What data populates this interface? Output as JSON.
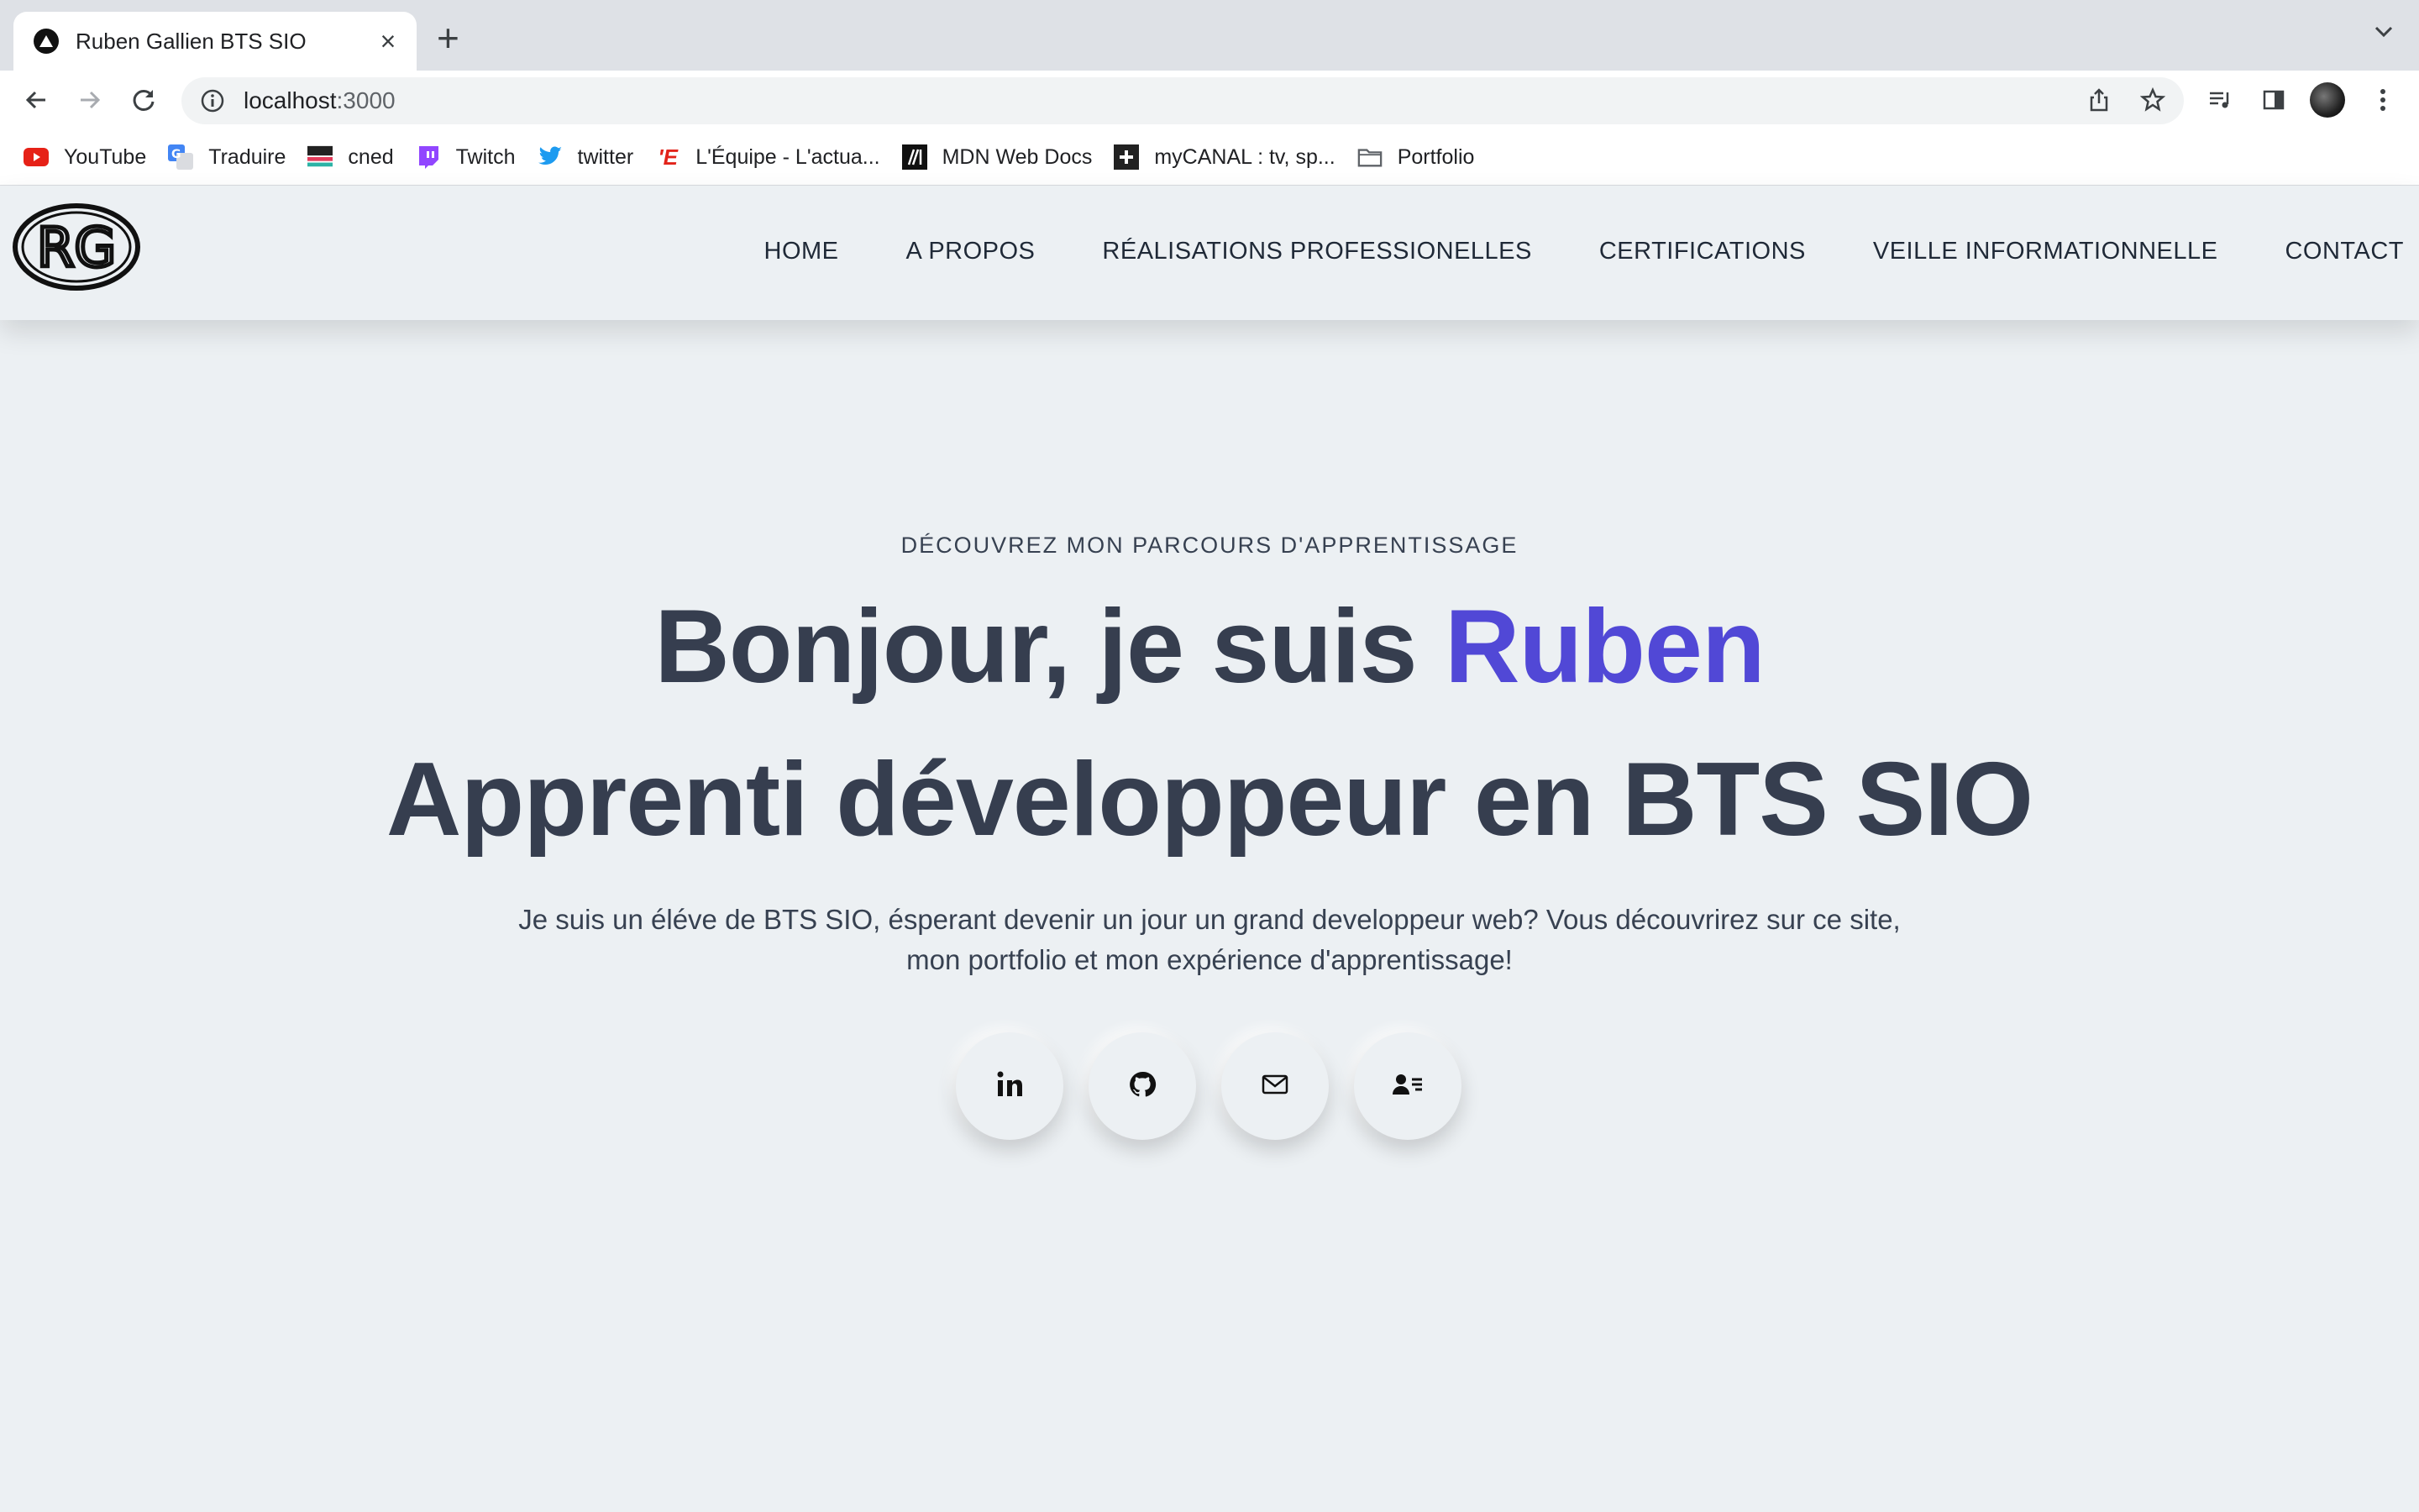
{
  "browser": {
    "tab_title": "Ruben Gallien BTS SIO",
    "url_host": "localhost",
    "url_port": ":3000",
    "bookmarks": [
      {
        "label": "YouTube",
        "icon": "youtube-icon"
      },
      {
        "label": "Traduire",
        "icon": "translate-icon"
      },
      {
        "label": "cned",
        "icon": "cned-icon"
      },
      {
        "label": "Twitch",
        "icon": "twitch-icon"
      },
      {
        "label": "twitter",
        "icon": "twitter-icon"
      },
      {
        "label": "L'Équipe - L'actua...",
        "icon": "lequipe-icon"
      },
      {
        "label": "MDN Web Docs",
        "icon": "mdn-icon"
      },
      {
        "label": "myCANAL : tv, sp...",
        "icon": "mycanal-icon"
      },
      {
        "label": "Portfolio",
        "icon": "folder-icon"
      }
    ]
  },
  "site": {
    "logo_text": "RG",
    "nav": [
      "HOME",
      "A PROPOS",
      "RÉALISATIONS PROFESSIONELLES",
      "CERTIFICATIONS",
      "VEILLE INFORMATIONNELLE",
      "CONTACT"
    ],
    "eyebrow": "DÉCOUVREZ MON PARCOURS D'APPRENTISSAGE",
    "greeting_prefix": "Bonjour, je suis ",
    "greeting_name": "Ruben",
    "subtitle": "Apprenti développeur en BTS SIO",
    "description_line1": "Je suis un éléve de BTS SIO, ésperant devenir un jour un grand developpeur web? Vous découvrirez sur ce site,",
    "description_line2": "mon portfolio et mon expérience d'apprentissage!",
    "socials": [
      "linkedin-icon",
      "github-icon",
      "mail-icon",
      "contact-card-icon"
    ]
  },
  "colors": {
    "accent": "#5148d6",
    "heading": "#363e4f",
    "background": "#ecf0f3"
  }
}
